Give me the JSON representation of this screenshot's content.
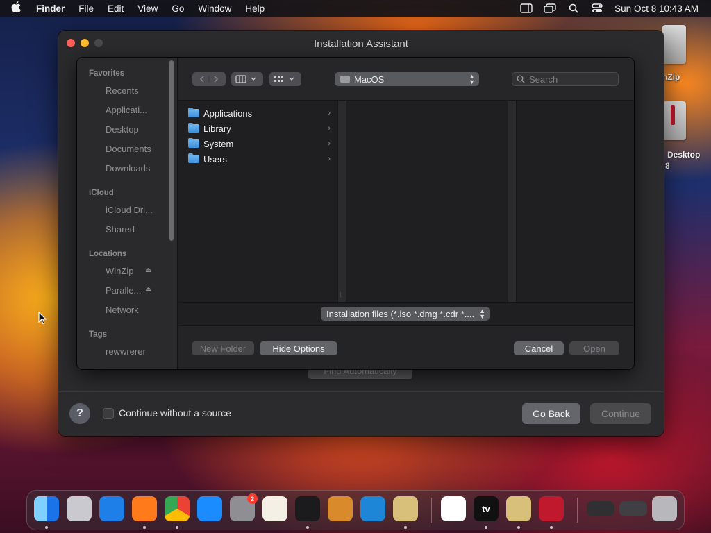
{
  "menubar": {
    "app_name": "Finder",
    "items": [
      "File",
      "Edit",
      "View",
      "Go",
      "Window",
      "Help"
    ],
    "clock": "Sun Oct 8  10:43 AM"
  },
  "desktop": {
    "icons": [
      {
        "label": "nZip"
      },
      {
        "label": "Desktop",
        "sublabel": "8"
      }
    ]
  },
  "window": {
    "title": "Installation Assistant",
    "hidden_button": "Find Automatically",
    "checkbox_label": "Continue without a source",
    "help": "?",
    "go_back": "Go Back",
    "continue": "Continue"
  },
  "dialog": {
    "sidebar": {
      "sections": [
        {
          "header": "Favorites",
          "items": [
            "Recents",
            "Applicati...",
            "Desktop",
            "Documents",
            "Downloads"
          ]
        },
        {
          "header": "iCloud",
          "items": [
            "iCloud Dri...",
            "Shared"
          ]
        },
        {
          "header": "Locations",
          "items": [
            "WinZip",
            "Paralle...",
            "Network"
          ]
        },
        {
          "header": "Tags",
          "items": [
            "rewwrerer"
          ]
        }
      ]
    },
    "location": "MacOS",
    "search_placeholder": "Search",
    "items": [
      "Applications",
      "Library",
      "System",
      "Users"
    ],
    "file_format": "Installation files (*.iso *.dmg *.cdr *....",
    "new_folder": "New Folder",
    "hide_options": "Hide Options",
    "cancel": "Cancel",
    "open": "Open"
  },
  "dock": {
    "apps": [
      {
        "icon": "finder-icon",
        "color": "#2a8cf0"
      },
      {
        "icon": "launchpad-icon",
        "color": "#c9c9cf"
      },
      {
        "icon": "safari-icon",
        "color": "#1f7fe8"
      },
      {
        "icon": "firefox-icon",
        "color": "#ff7a1a"
      },
      {
        "icon": "chrome-icon",
        "color": "#f1f1f1"
      },
      {
        "icon": "app-store-icon",
        "color": "#1a8cff"
      },
      {
        "icon": "system-settings-icon",
        "color": "#8e8e93",
        "badge": "2"
      },
      {
        "icon": "textedit-icon",
        "color": "#f4f0e6"
      },
      {
        "icon": "terminal-icon",
        "color": "#1b1b1d"
      },
      {
        "icon": "garageband-icon",
        "color": "#d98a2a"
      },
      {
        "icon": "vscode-icon",
        "color": "#1e86d6"
      },
      {
        "icon": "archive-utility-icon",
        "color": "#d8c07a"
      },
      {
        "icon": "freeform-icon",
        "color": "#ffffff"
      },
      {
        "icon": "apple-tv-icon",
        "color": "#111111",
        "label": "tv"
      },
      {
        "icon": "archive-utility-icon-2",
        "color": "#d8c07a"
      },
      {
        "icon": "parallels-icon",
        "color": "#c0182c"
      },
      {
        "icon": "window-thumbnail-icon",
        "color": "#303033"
      },
      {
        "icon": "window-thumbnail-icon-2",
        "color": "#404044"
      },
      {
        "icon": "trash-icon",
        "color": "#b8b8bc"
      }
    ]
  }
}
